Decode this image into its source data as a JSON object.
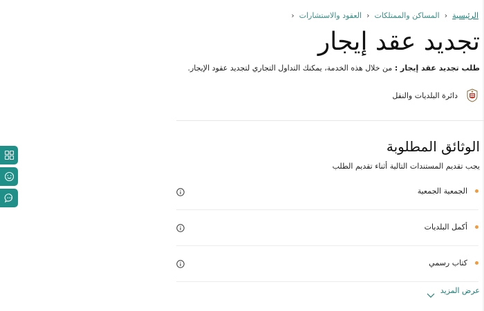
{
  "breadcrumb": {
    "home": "الرئيسية",
    "level2": "المساكن والممتلكات",
    "level3": "العقود والاستشارات"
  },
  "page": {
    "title": "تجديد عقد إيجار",
    "intro_bold": "طلب تجديد عقد إيجار :",
    "intro_text": " من خلال هذه الخدمة، يمكنك التداول التجاري لتجديد عقود الإيجار."
  },
  "department": {
    "name": "دائرة البلديات والنقل",
    "logo_icon": "emblem-icon"
  },
  "documents": {
    "title": "الوثائق المطلوبة",
    "subtitle": "يجب تقديم المستندات التالية أثناء تقديم الطلب",
    "items": [
      {
        "label": "الجمعية الجمعية"
      },
      {
        "label": "أكمل البلديات"
      },
      {
        "label": "كتاب رسمي"
      }
    ],
    "show_more": "عرض المزيد"
  },
  "side_buttons": [
    {
      "icon": "grid-icon"
    },
    {
      "icon": "smiley-icon"
    },
    {
      "icon": "chat-icon"
    }
  ],
  "colors": {
    "accent": "#1f8f88",
    "link": "#1d7f77",
    "bullet": "#f39a3c"
  }
}
